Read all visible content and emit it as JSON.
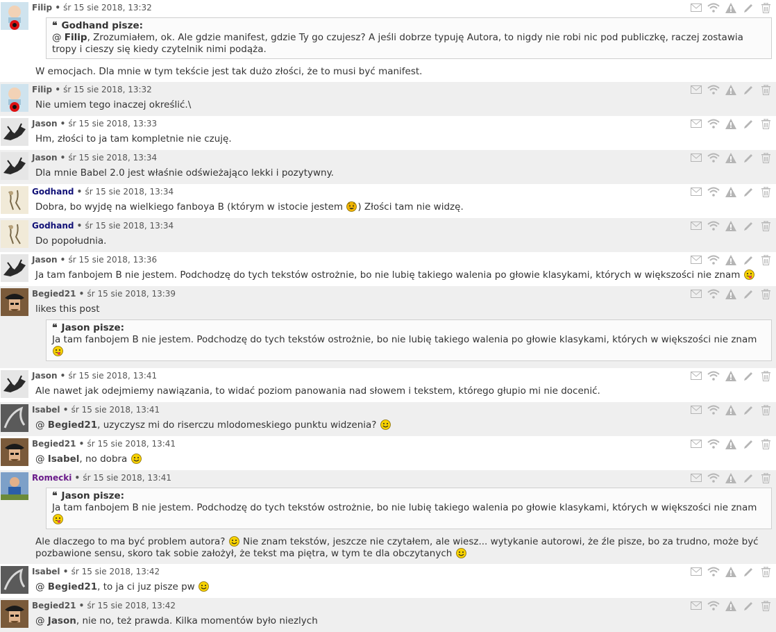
{
  "posts": [
    {
      "author": "Filip",
      "author_color": "default",
      "meta": "śr 15 sie 2018, 13:32",
      "avatar": "filip",
      "quote": {
        "head": "Godhand pisze:",
        "mention": "Filip",
        "text": ", Zrozumiałem, ok. Ale gdzie manifest, gdzie Ty go czujesz? A jeśli dobrze typuję Autora, to nigdy nie robi nic pod publiczkę, raczej zostawia tropy i cieszy się kiedy czytelnik nimi podąża."
      },
      "pre": "",
      "mention": "",
      "text": "W emocjach. Dla mnie w tym tekście jest tak dużo złości, że to musi być manifest.",
      "smiley": ""
    },
    {
      "author": "Filip",
      "author_color": "default",
      "meta": "śr 15 sie 2018, 13:32",
      "avatar": "filip",
      "pre": "",
      "mention": "",
      "text": "Nie umiem tego inaczej określić.\\",
      "smiley": ""
    },
    {
      "author": "Jason",
      "author_color": "default",
      "meta": "śr 15 sie 2018, 13:33",
      "avatar": "jason",
      "pre": "",
      "mention": "",
      "text": "Hm, złości to ja tam kompletnie nie czuję.",
      "smiley": ""
    },
    {
      "author": "Jason",
      "author_color": "default",
      "meta": "śr 15 sie 2018, 13:34",
      "avatar": "jason",
      "pre": "",
      "mention": "",
      "text": "Dla mnie Babel 2.0 jest właśnie odświeżająco lekki i pozytywny.",
      "smiley": ""
    },
    {
      "author": "Godhand",
      "author_color": "blue",
      "meta": "śr 15 sie 2018, 13:34",
      "avatar": "godhand",
      "pre": "",
      "mention": "",
      "text": "Dobra, bo wyjdę na wielkiego fanboya B (którym w istocie jestem ",
      "smiley": "devil",
      "tail": ") Złości tam nie widzę."
    },
    {
      "author": "Godhand",
      "author_color": "blue",
      "meta": "śr 15 sie 2018, 13:34",
      "avatar": "godhand",
      "pre": "",
      "mention": "",
      "text": "Do popołudnia.",
      "smiley": ""
    },
    {
      "author": "Jason",
      "author_color": "default",
      "meta": "śr 15 sie 2018, 13:36",
      "avatar": "jason",
      "pre": "",
      "mention": "",
      "text": "Ja tam fanbojem B nie jestem. Podchodzę do tych tekstów ostrożnie, bo nie lubię takiego walenia po głowie klasykami, których w większości nie znam ",
      "smiley": "tongue"
    },
    {
      "author": "Begied21",
      "author_color": "default",
      "meta": "śr 15 sie 2018, 13:39",
      "avatar": "begied",
      "pre": "",
      "mention": "",
      "text": "likes this post",
      "smiley": "",
      "quote_after": {
        "head": "Jason pisze:",
        "text": "Ja tam fanbojem B nie jestem. Podchodzę do tych tekstów ostrożnie, bo nie lubię takiego walenia po głowie klasykami, których w większości nie znam ",
        "smiley": "tongue"
      }
    },
    {
      "author": "Jason",
      "author_color": "default",
      "meta": "śr 15 sie 2018, 13:41",
      "avatar": "jason",
      "pre": "",
      "mention": "",
      "text": "Ale nawet jak odejmiemy nawiązania, to widać poziom panowania nad słowem i tekstem, którego głupio mi nie docenić.",
      "smiley": ""
    },
    {
      "author": "Isabel",
      "author_color": "default",
      "meta": "śr 15 sie 2018, 13:41",
      "avatar": "isabel",
      "pre": "@ ",
      "mention": "Begied21",
      "text": ", uzyczysz mi do riserczu mlodomeskiego punktu widzenia? ",
      "smiley": "smile"
    },
    {
      "author": "Begied21",
      "author_color": "default",
      "meta": "śr 15 sie 2018, 13:41",
      "avatar": "begied",
      "pre": "@ ",
      "mention": "Isabel",
      "text": ", no dobra ",
      "smiley": "smile"
    },
    {
      "author": "Romecki",
      "author_color": "purple",
      "meta": "śr 15 sie 2018, 13:41",
      "avatar": "romecki",
      "quote": {
        "head": "Jason pisze:",
        "mention": "",
        "text": "Ja tam fanbojem B nie jestem. Podchodzę do tych tekstów ostrożnie, bo nie lubię takiego walenia po głowie klasykami, których w większości nie znam ",
        "smiley": "tongue"
      },
      "pre": "",
      "mention": "",
      "text": "Ale dlaczego to ma być problem autora? ",
      "smiley": "smile",
      "tail": " Nie znam tekstów, jeszcze nie czytałem, ale wiesz... wytykanie autorowi, że źle pisze, bo za trudno, może być pozbawione sensu, skoro tak sobie założył, że tekst ma piętra, w tym te dla obczytanych ",
      "smiley2": "smile"
    },
    {
      "author": "Isabel",
      "author_color": "default",
      "meta": "śr 15 sie 2018, 13:42",
      "avatar": "isabel",
      "pre": "@ ",
      "mention": "Begied21",
      "text": ", to ja ci juz pisze pw ",
      "smiley": "smile"
    },
    {
      "author": "Begied21",
      "author_color": "default",
      "meta": "śr 15 sie 2018, 13:42",
      "avatar": "begied",
      "pre": "@ ",
      "mention": "Jason",
      "text": ", nie no, też prawda. Kilka momentów było niezlych",
      "smiley": ""
    }
  ],
  "action_icons": [
    "mail-icon",
    "wifi-icon",
    "warning-icon",
    "pencil-icon",
    "trash-icon"
  ],
  "colors": {
    "odd_row": "#efefef",
    "even_row": "#ffffff",
    "godhand": "#111177",
    "romecki": "#6a1b8a",
    "icon": "#b5b5b5"
  }
}
